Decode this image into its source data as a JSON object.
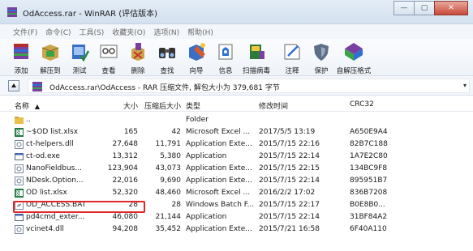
{
  "window": {
    "title": "OdAccess.rar - WinRAR (评估版本)",
    "minimize_glyph": "—",
    "maximize_glyph": "▢",
    "close_glyph": "✕"
  },
  "menu": {
    "items": [
      "文件(F)",
      "命令(C)",
      "工具(S)",
      "收藏夹(O)",
      "选项(N)",
      "帮助(H)"
    ]
  },
  "toolbar": {
    "items": [
      {
        "label": "添加",
        "icon": "add-icon"
      },
      {
        "label": "解压到",
        "icon": "extract-to-icon"
      },
      {
        "label": "测试",
        "icon": "test-icon"
      },
      {
        "label": "查看",
        "icon": "view-icon"
      },
      {
        "label": "删除",
        "icon": "delete-icon"
      },
      {
        "label": "查找",
        "icon": "find-icon"
      },
      {
        "label": "向导",
        "icon": "wizard-icon"
      },
      {
        "label": "信息",
        "icon": "info-icon"
      },
      {
        "label": "扫描病毒",
        "icon": "virus-scan-icon"
      },
      {
        "label": "注释",
        "icon": "comment-icon"
      },
      {
        "label": "保护",
        "icon": "protect-icon"
      },
      {
        "label": "自解压格式",
        "icon": "sfx-icon"
      }
    ]
  },
  "address": {
    "path": "OdAccess.rar\\OdAccess - RAR 压缩文件, 解包大小为 379,681 字节"
  },
  "columns": {
    "name": "名称",
    "size": "大小",
    "packed": "压缩后大小",
    "type": "类型",
    "modified": "修改时间",
    "crc": "CRC32"
  },
  "files": [
    {
      "name": "..",
      "size": "",
      "packed": "",
      "type": "Folder",
      "modified": "",
      "crc": "",
      "icon": "folder-icon"
    },
    {
      "name": "~$OD list.xlsx",
      "size": "165",
      "packed": "42",
      "type": "Microsoft Excel ...",
      "modified": "2017/5/5 13:19",
      "crc": "A650E9A4",
      "icon": "excel-icon"
    },
    {
      "name": "ct-helpers.dll",
      "size": "27,648",
      "packed": "11,791",
      "type": "Application Exte...",
      "modified": "2015/7/15 22:16",
      "crc": "82B7C188",
      "icon": "dll-icon"
    },
    {
      "name": "ct-od.exe",
      "size": "13,312",
      "packed": "5,380",
      "type": "Application",
      "modified": "2015/7/15 22:14",
      "crc": "1A7E2C80",
      "icon": "exe-icon"
    },
    {
      "name": "NanoFieldbus...",
      "size": "123,904",
      "packed": "43,073",
      "type": "Application Exte...",
      "modified": "2015/7/15 22:15",
      "crc": "134BC9F8",
      "icon": "dll-icon"
    },
    {
      "name": "NDesk.Option...",
      "size": "22,016",
      "packed": "9,690",
      "type": "Application Exte...",
      "modified": "2015/7/15 22:14",
      "crc": "895951B7",
      "icon": "dll-icon"
    },
    {
      "name": "OD list.xlsx",
      "size": "52,320",
      "packed": "48,460",
      "type": "Microsoft Excel ...",
      "modified": "2016/2/2 17:02",
      "crc": "836B7208",
      "icon": "excel-icon"
    },
    {
      "name": "OD_ACCESS.BAT",
      "size": "28",
      "packed": "28",
      "type": "Windows Batch F...",
      "modified": "2015/7/15 22:17",
      "crc": "B0E8B0...",
      "icon": "bat-icon"
    },
    {
      "name": "pd4cmd_exter...",
      "size": "46,080",
      "packed": "21,144",
      "type": "Application",
      "modified": "2015/7/15 22:14",
      "crc": "31BF84A2",
      "icon": "exe-icon"
    },
    {
      "name": "vcinet4.dll",
      "size": "94,208",
      "packed": "35,452",
      "type": "Application Exte...",
      "modified": "2015/7/21 16:58",
      "crc": "6F40A110",
      "icon": "dll-icon"
    }
  ],
  "colors": {
    "highlight_border": "#e0282a",
    "titlebar": "#d3e0ef"
  }
}
